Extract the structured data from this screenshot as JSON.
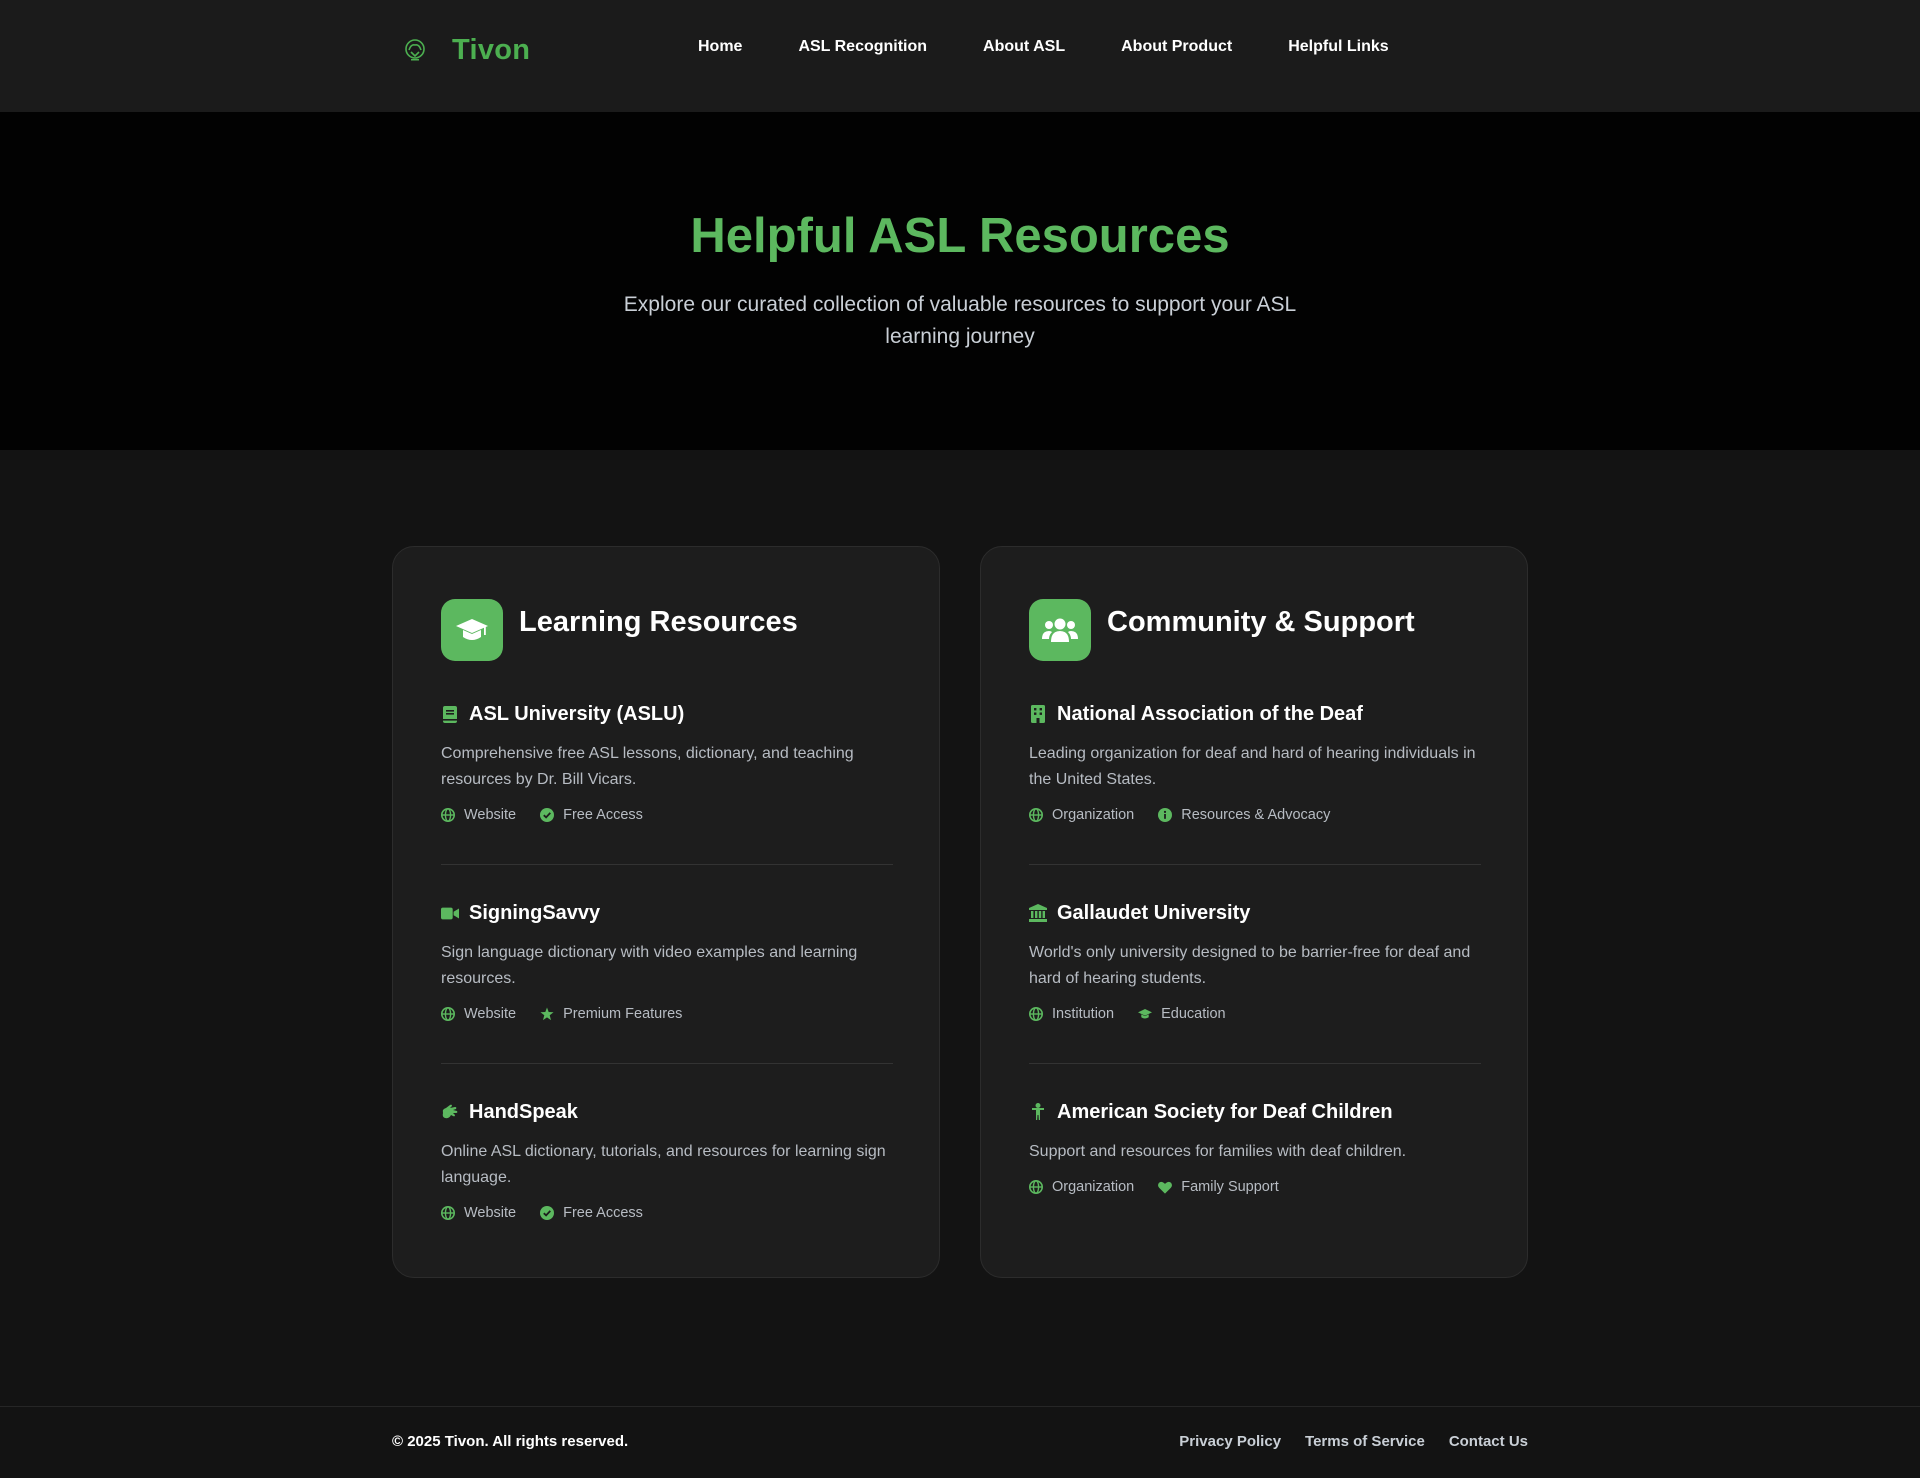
{
  "brand": {
    "name": "Tivon",
    "accent": "#5cb85f"
  },
  "nav": {
    "links": [
      "Home",
      "ASL Recognition",
      "About ASL",
      "About Product",
      "Helpful Links"
    ]
  },
  "hero": {
    "title": "Helpful ASL Resources",
    "subtitle": "Explore our curated collection of valuable resources to support your ASL learning journey"
  },
  "cards": [
    {
      "title": "Learning Resources",
      "icon": "graduation-cap-icon",
      "items": [
        {
          "title": "ASL University (ASLU)",
          "icon": "book-icon",
          "desc": "Comprehensive free ASL lessons, dictionary, and teaching resources by Dr. Bill Vicars.",
          "tags": [
            {
              "label": "Website",
              "icon": "globe-icon"
            },
            {
              "label": "Free Access",
              "icon": "check-circle-icon"
            }
          ]
        },
        {
          "title": "SigningSavvy",
          "icon": "video-icon",
          "desc": "Sign language dictionary with video examples and learning resources.",
          "tags": [
            {
              "label": "Website",
              "icon": "globe-icon"
            },
            {
              "label": "Premium Features",
              "icon": "star-icon"
            }
          ]
        },
        {
          "title": "HandSpeak",
          "icon": "hands-icon",
          "desc": "Online ASL dictionary, tutorials, and resources for learning sign language.",
          "tags": [
            {
              "label": "Website",
              "icon": "globe-icon"
            },
            {
              "label": "Free Access",
              "icon": "check-circle-icon"
            }
          ]
        }
      ]
    },
    {
      "title": "Community & Support",
      "icon": "users-icon",
      "items": [
        {
          "title": "National Association of the Deaf",
          "icon": "building-icon",
          "desc": "Leading organization for deaf and hard of hearing individuals in the United States.",
          "tags": [
            {
              "label": "Organization",
              "icon": "globe-icon"
            },
            {
              "label": "Resources & Advocacy",
              "icon": "info-icon"
            }
          ]
        },
        {
          "title": "Gallaudet University",
          "icon": "university-icon",
          "desc": "World's only university designed to be barrier-free for deaf and hard of hearing students.",
          "tags": [
            {
              "label": "Institution",
              "icon": "globe-icon"
            },
            {
              "label": "Education",
              "icon": "graduation-cap-icon"
            }
          ]
        },
        {
          "title": "American Society for Deaf Children",
          "icon": "child-icon",
          "desc": "Support and resources for families with deaf children.",
          "tags": [
            {
              "label": "Organization",
              "icon": "globe-icon"
            },
            {
              "label": "Family Support",
              "icon": "heart-icon"
            }
          ]
        }
      ]
    }
  ],
  "footer": {
    "copyright": "© 2025 Tivon. All rights reserved.",
    "links": [
      "Privacy Policy",
      "Terms of Service",
      "Contact Us"
    ]
  }
}
